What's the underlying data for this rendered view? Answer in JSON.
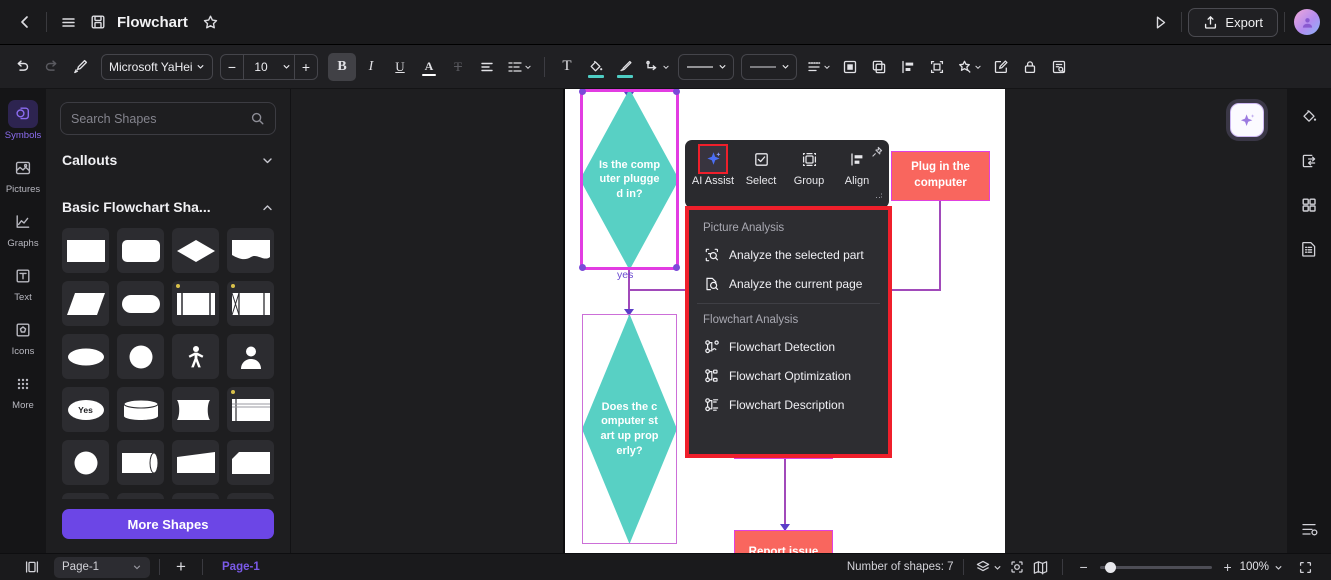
{
  "titlebar": {
    "back_icon": "chevron-left-icon",
    "menu_icon": "hamburger-menu-icon",
    "save_icon": "save-disk-icon",
    "title": "Flowchart",
    "favorite_icon": "star-icon",
    "present_icon": "play-triangle-icon",
    "export_icon": "share-upload-icon",
    "export_label": "Export",
    "avatar_icon": "user-avatar"
  },
  "toolbar": {
    "undo_icon": "undo-arrow-icon",
    "redo_icon": "redo-arrow-icon",
    "format_painter_icon": "format-painter-icon",
    "font_family": "Microsoft YaHei",
    "font_size": "10",
    "decrease_label": "−",
    "increase_label": "+",
    "bold_label": "B",
    "italic_label": "I",
    "underline_label": "U",
    "text_color_label": "A",
    "strikethrough_label": "T",
    "align_icon": "align-left-icon",
    "line_spacing_icon": "line-spacing-icon",
    "text_box_label": "T",
    "fill_color_icon": "paint-bucket-icon",
    "line_color_icon": "brush-icon",
    "connector_icon": "connector-style-icon",
    "border_style_value": "——",
    "line_weight_value": "——",
    "dash_icon": "dashed-line-icon",
    "bring_front_icon": "bring-to-front-icon",
    "duplicate_icon": "duplicate-layers-icon",
    "align_objects_icon": "align-objects-icon",
    "fit_frame_icon": "fit-to-frame-icon",
    "magic_icon": "magic-wand-icon",
    "edit_icon": "edit-pencil-icon",
    "lock_icon": "lock-icon",
    "find_icon": "find-replace-icon"
  },
  "left_rail": {
    "items": [
      {
        "label": "Symbols",
        "icon": "symbols-cube-icon",
        "selected": true
      },
      {
        "label": "Pictures",
        "icon": "picture-image-icon",
        "selected": false
      },
      {
        "label": "Graphs",
        "icon": "graph-chart-icon",
        "selected": false
      },
      {
        "label": "Text",
        "icon": "text-box-icon",
        "selected": false
      },
      {
        "label": "Icons",
        "icon": "icons-shape-icon",
        "selected": false
      },
      {
        "label": "More",
        "icon": "more-grid-dots-icon",
        "selected": false
      }
    ]
  },
  "shapes_panel": {
    "search_placeholder": "Search Shapes",
    "search_value": "",
    "search_icon": "search-icon",
    "sections": [
      {
        "label": "Callouts",
        "expanded": false,
        "chevron": "chevron-down-icon"
      },
      {
        "label": "Basic Flowchart Sha...",
        "expanded": true,
        "chevron": "chevron-up-icon"
      }
    ],
    "shape_cells": [
      "rectangle",
      "rounded-rectangle",
      "diamond",
      "wave-document",
      "parallelogram",
      "stadium",
      "predefined-process",
      "internal-storage",
      "ellipse",
      "circle",
      "person-stick",
      "actor-bust",
      "decision-yes-oval",
      "cylinder-database",
      "curved-tape",
      "multi-band",
      "circle-connector",
      "cylinder-side",
      "trapezoid-slant",
      "torn-paper"
    ],
    "yes_cell_label": "Yes",
    "more_shapes_label": "More Shapes"
  },
  "canvas": {
    "nodes": [
      {
        "id": "d1",
        "type": "diamond",
        "text": "Is the computer plugged in?",
        "selected": true
      },
      {
        "id": "d2",
        "type": "diamond",
        "text": "Does the computer start up properly?",
        "selected": true
      },
      {
        "id": "r1",
        "type": "rect",
        "text": "Plug in the computer"
      },
      {
        "id": "r2",
        "type": "rect",
        "text": "Report issue"
      }
    ],
    "edge_labels": [
      "yes"
    ]
  },
  "floating_toolbar": {
    "items": [
      {
        "label": "AI Assist",
        "icon": "ai-sparkle-icon",
        "highlighted": true
      },
      {
        "label": "Select",
        "icon": "checkbox-select-icon",
        "highlighted": false
      },
      {
        "label": "Group",
        "icon": "group-objects-icon",
        "highlighted": false
      },
      {
        "label": "Align",
        "icon": "align-left-objects-icon",
        "highlighted": false
      }
    ],
    "pin_icon": "pin-icon",
    "more_icon": "more-corner-icon"
  },
  "ai_menu": {
    "groups": [
      {
        "label": "Picture Analysis",
        "items": [
          {
            "label": "Analyze the selected part",
            "icon": "analyze-selection-icon"
          },
          {
            "label": "Analyze the current page",
            "icon": "analyze-page-icon"
          }
        ]
      },
      {
        "label": "Flowchart Analysis",
        "items": [
          {
            "label": "Flowchart Detection",
            "icon": "flowchart-detection-icon"
          },
          {
            "label": "Flowchart Optimization",
            "icon": "flowchart-optimization-icon"
          },
          {
            "label": "Flowchart Description",
            "icon": "flowchart-description-icon"
          }
        ]
      }
    ],
    "highlight_color": "#ef1f2b"
  },
  "ai_orb": {
    "icon": "ai-sparkle-orb-icon"
  },
  "right_rail": {
    "items": [
      {
        "icon": "theme-fill-icon"
      },
      {
        "icon": "swap-replace-icon"
      },
      {
        "icon": "grid-apps-icon"
      },
      {
        "icon": "document-outline-icon"
      }
    ],
    "bottom_icon": "settings-sliders-icon"
  },
  "statusbar": {
    "panel_toggle_icon": "panel-toggle-icon",
    "page_select_value": "Page-1",
    "page_select_chevron": "chevron-down-icon",
    "add_page_label": "+",
    "active_tab_label": "Page-1",
    "shape_count_label": "Number of shapes: 7",
    "layers_icon": "layers-icon",
    "layers_chevron": "chevron-down-icon",
    "focus_icon": "focus-frame-icon",
    "map_icon": "mini-map-icon",
    "zoom_out_label": "−",
    "zoom_in_label": "+",
    "zoom_value": "100%",
    "zoom_chevron": "chevron-down-icon",
    "fullscreen_icon": "fullscreen-icon"
  },
  "colors": {
    "accent_purple": "#6c46e6",
    "diamond_teal": "#58d0c4",
    "rect_red": "#f9665e",
    "selection_magenta": "#e23ce2",
    "highlight_red": "#ef1f2b"
  }
}
